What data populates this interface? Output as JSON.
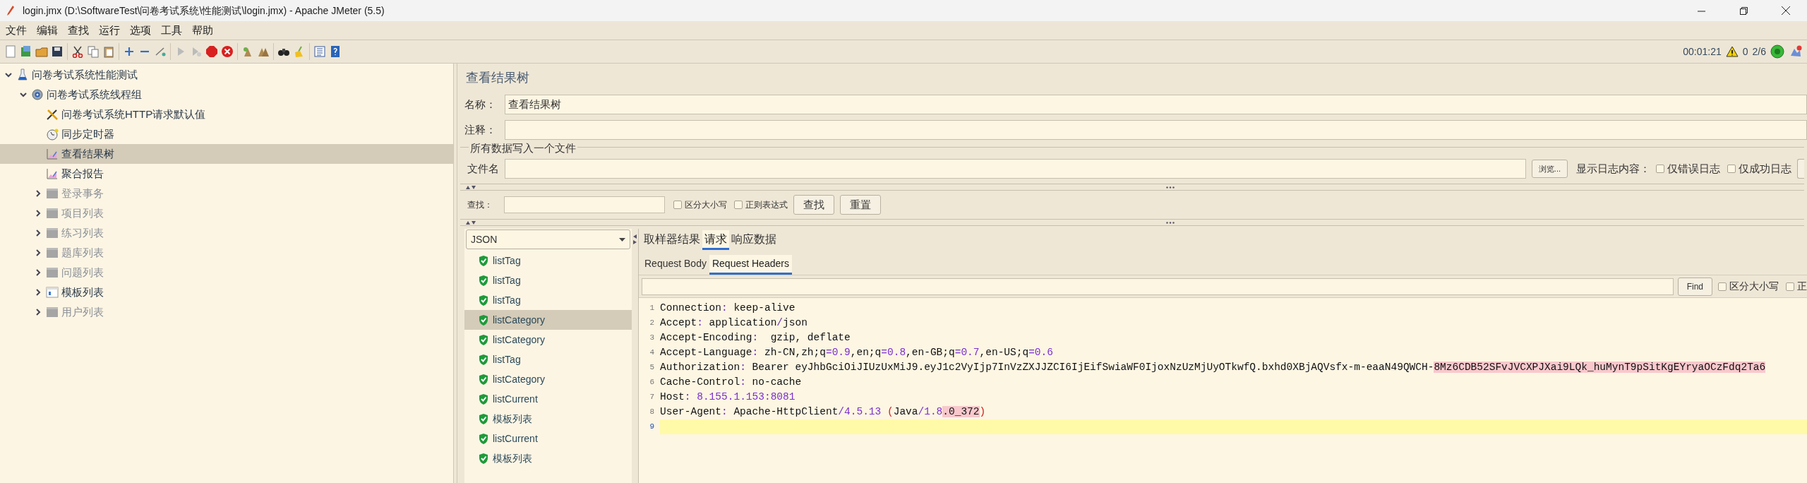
{
  "window": {
    "title": "login.jmx (D:\\SoftwareTest\\问卷考试系统\\性能测试\\login.jmx) - Apache JMeter (5.5)"
  },
  "menu": [
    "文件",
    "编辑",
    "查找",
    "运行",
    "选项",
    "工具",
    "帮助"
  ],
  "status": {
    "elapsed": "00:01:21",
    "errors": "0",
    "threads": "2/6",
    "running": true
  },
  "tree": [
    {
      "label": "问卷考试系统性能测试",
      "kind": "plan",
      "expanded": true,
      "disabled": false,
      "selected": false,
      "children": [
        {
          "label": "问卷考试系统线程组",
          "kind": "thread-group",
          "expanded": true,
          "disabled": false,
          "selected": false,
          "children": [
            {
              "label": "问卷考试系统HTTP请求默认值",
              "kind": "config",
              "disabled": false,
              "selected": false
            },
            {
              "label": "同步定时器",
              "kind": "timer",
              "disabled": false,
              "selected": false
            },
            {
              "label": "查看结果树",
              "kind": "listener",
              "disabled": false,
              "selected": true
            },
            {
              "label": "聚合报告",
              "kind": "listener",
              "disabled": false,
              "selected": false
            },
            {
              "label": "登录事务",
              "kind": "controller",
              "expanded": false,
              "disabled": true,
              "selected": false
            },
            {
              "label": "项目列表",
              "kind": "controller",
              "expanded": false,
              "disabled": true,
              "selected": false
            },
            {
              "label": "练习列表",
              "kind": "controller",
              "expanded": false,
              "disabled": true,
              "selected": false
            },
            {
              "label": "题库列表",
              "kind": "controller",
              "expanded": false,
              "disabled": true,
              "selected": false
            },
            {
              "label": "问题列表",
              "kind": "controller",
              "expanded": false,
              "disabled": true,
              "selected": false
            },
            {
              "label": "模板列表",
              "kind": "controller",
              "expanded": false,
              "disabled": false,
              "selected": false
            },
            {
              "label": "用户列表",
              "kind": "controller",
              "expanded": false,
              "disabled": true,
              "selected": false
            }
          ]
        }
      ]
    }
  ],
  "panel": {
    "title": "查看结果树",
    "name_label": "名称：",
    "name_value": "查看结果树",
    "comment_label": "注释：",
    "file_legend": "所有数据写入一个文件",
    "file_label": "文件名",
    "browse_button": "浏览...",
    "log_label": "显示日志内容：",
    "log_checkboxes": [
      {
        "label": "仅错误日志",
        "checked": false
      },
      {
        "label": "仅成功日志",
        "checked": false
      }
    ]
  },
  "search": {
    "label": "查找：",
    "checkboxes": [
      {
        "label": "区分大小写",
        "checked": false
      },
      {
        "label": "正则表达式",
        "checked": false
      }
    ],
    "buttons": [
      "查找",
      "重置"
    ]
  },
  "results": {
    "renderer": "JSON",
    "samples": [
      {
        "label": "listTag",
        "selected": false
      },
      {
        "label": "listTag",
        "selected": false
      },
      {
        "label": "listTag",
        "selected": false
      },
      {
        "label": "listCategory",
        "selected": true
      },
      {
        "label": "listCategory",
        "selected": false
      },
      {
        "label": "listTag",
        "selected": false
      },
      {
        "label": "listCategory",
        "selected": false
      },
      {
        "label": "listCurrent",
        "selected": false
      },
      {
        "label": "模板列表",
        "selected": false
      },
      {
        "label": "listCurrent",
        "selected": false
      },
      {
        "label": "模板列表",
        "selected": false
      }
    ],
    "tabs": [
      {
        "label": "取样器结果",
        "selected": false
      },
      {
        "label": "请求",
        "selected": true
      },
      {
        "label": "响应数据",
        "selected": false
      }
    ],
    "subtabs": [
      {
        "label": "Request Body",
        "selected": false
      },
      {
        "label": "Request Headers",
        "selected": true
      }
    ],
    "find_button": "Find",
    "find_checkboxes": [
      {
        "label": "区分大小写",
        "checked": false
      },
      {
        "label": "正",
        "checked": false
      }
    ],
    "lines": [
      {
        "number": "1",
        "current": false,
        "parts": [
          {
            "text": "Connection",
            "kind": "plain"
          },
          {
            "text": ":",
            "kind": "op"
          },
          {
            "text": " keep-alive",
            "kind": "plain"
          }
        ]
      },
      {
        "number": "2",
        "current": false,
        "parts": [
          {
            "text": "Accept",
            "kind": "plain"
          },
          {
            "text": ":",
            "kind": "op"
          },
          {
            "text": " application",
            "kind": "plain"
          },
          {
            "text": "/",
            "kind": "op"
          },
          {
            "text": "json",
            "kind": "plain"
          }
        ]
      },
      {
        "number": "3",
        "current": false,
        "parts": [
          {
            "text": "Accept-Encoding",
            "kind": "plain"
          },
          {
            "text": ":",
            "kind": "op"
          },
          {
            "text": "  gzip, deflate",
            "kind": "plain"
          }
        ]
      },
      {
        "number": "4",
        "current": false,
        "parts": [
          {
            "text": "Accept-Language",
            "kind": "plain"
          },
          {
            "text": ":",
            "kind": "op"
          },
          {
            "text": " zh-CN,zh;q",
            "kind": "plain"
          },
          {
            "text": "=0.9",
            "kind": "num"
          },
          {
            "text": ",en;q",
            "kind": "plain"
          },
          {
            "text": "=0.8",
            "kind": "num"
          },
          {
            "text": ",en-GB;q",
            "kind": "plain"
          },
          {
            "text": "=0.7",
            "kind": "num"
          },
          {
            "text": ",en-US;q",
            "kind": "plain"
          },
          {
            "text": "=0.6",
            "kind": "num"
          }
        ]
      },
      {
        "number": "5",
        "current": false,
        "parts": [
          {
            "text": "Authorization",
            "kind": "plain"
          },
          {
            "text": ":",
            "kind": "op"
          },
          {
            "text": " Bearer eyJhbGciOiJIUzUxMiJ9.eyJ1c2VyIjp7InVzZXJJZCI6IjEifSwiaWF0IjoxNzUzMjUyOTkwfQ.bxhd0XBjAQVsfx-m-eaaN49QWCH-",
            "kind": "plain"
          },
          {
            "text": "8Mz6CDB52SFvJVCXPJXai9LQk_huMynT9pSitKgEYryaOCzFdq2Ta6",
            "kind": "error"
          }
        ]
      },
      {
        "number": "6",
        "current": false,
        "parts": [
          {
            "text": "Cache-Control",
            "kind": "plain"
          },
          {
            "text": ":",
            "kind": "op"
          },
          {
            "text": " no-cache",
            "kind": "plain"
          }
        ]
      },
      {
        "number": "7",
        "current": false,
        "parts": [
          {
            "text": "Host",
            "kind": "plain"
          },
          {
            "text": ": ",
            "kind": "op"
          },
          {
            "text": "8.155.1.153:8081",
            "kind": "num"
          }
        ]
      },
      {
        "number": "8",
        "current": false,
        "parts": [
          {
            "text": "User-Agent",
            "kind": "plain"
          },
          {
            "text": ":",
            "kind": "op"
          },
          {
            "text": " Apache-HttpClient",
            "kind": "plain"
          },
          {
            "text": "/4.5.13",
            "kind": "num"
          },
          {
            "text": " (",
            "kind": "paren"
          },
          {
            "text": "Java",
            "kind": "plain"
          },
          {
            "text": "/1.8",
            "kind": "num"
          },
          {
            "text": ".0_372",
            "kind": "error"
          },
          {
            "text": ")",
            "kind": "paren"
          }
        ]
      },
      {
        "number": "9",
        "current": true
      }
    ]
  }
}
